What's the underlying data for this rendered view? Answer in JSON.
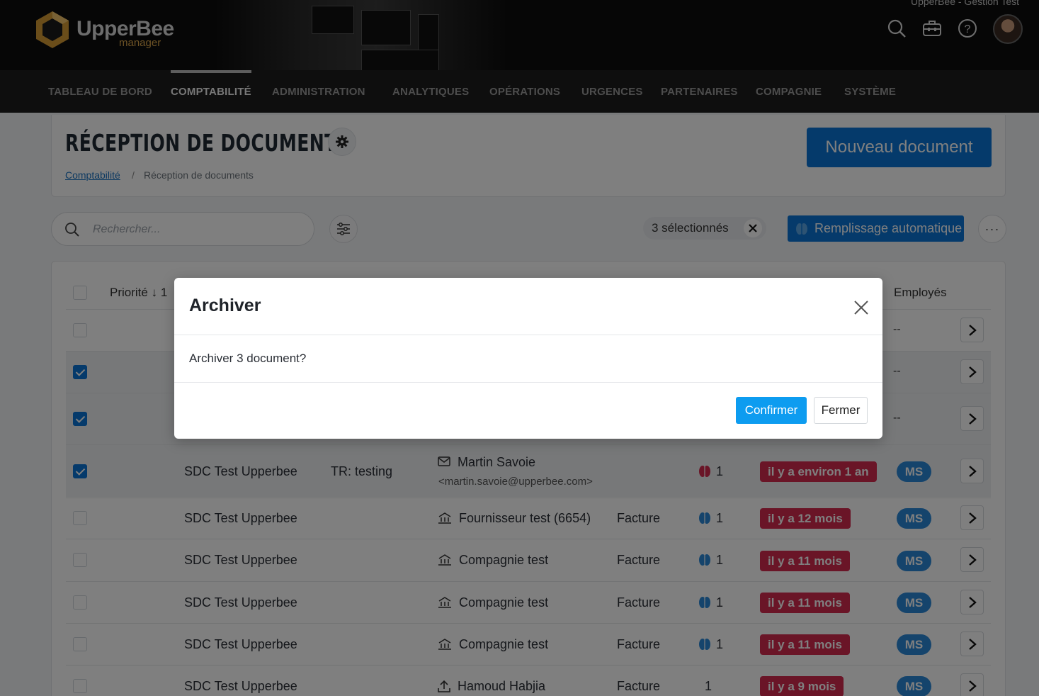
{
  "brand": {
    "name": "UpperBee",
    "sub": "manager",
    "tenant": "UpperBee - Gestion Test"
  },
  "header_icons": [
    "search-icon",
    "toolbox-icon",
    "help-icon"
  ],
  "nav": [
    {
      "label": "TABLEAU DE BORD"
    },
    {
      "label": "COMPTABILITÉ",
      "active": true
    },
    {
      "label": "ADMINISTRATION"
    },
    {
      "label": "ANALYTIQUES"
    },
    {
      "label": "OPÉRATIONS"
    },
    {
      "label": "URGENCES"
    },
    {
      "label": "PARTENAIRES"
    },
    {
      "label": "COMPAGNIE"
    },
    {
      "label": "SYSTÈME"
    }
  ],
  "page": {
    "title": "RÉCEPTION DE DOCUMENTS",
    "breadcrumb": {
      "link": "Comptabilité",
      "sep": "/",
      "current": "Réception de documents"
    },
    "new_button": "Nouveau document"
  },
  "toolbar": {
    "search_placeholder": "Rechercher...",
    "selected": "3 sélectionnés",
    "autofill": "Remplissage automatique",
    "more": "···"
  },
  "table": {
    "headers": {
      "priority": "Priorité",
      "priority_num": "1",
      "employees": "Employés"
    },
    "rows": [
      {
        "checked": false,
        "employees": "--"
      },
      {
        "checked": true,
        "employees": "--"
      },
      {
        "checked": true,
        "employees": "--"
      },
      {
        "checked": true,
        "company": "SDC Test Upperbee",
        "subject": "TR: testing",
        "sender_icon": "mail-icon",
        "sender": "Martin Savoie",
        "sender_email": "<martin.savoie@upperbee.com>",
        "type": "",
        "count": "1",
        "age": "il y a environ 1 an",
        "initials": "MS"
      },
      {
        "checked": false,
        "company": "SDC Test Upperbee",
        "subject": "",
        "sender_icon": "bank-icon",
        "sender": "Fournisseur test (6654)",
        "type": "Facture",
        "count": "1",
        "age": "il y a 12 mois",
        "initials": "MS"
      },
      {
        "checked": false,
        "company": "SDC Test Upperbee",
        "subject": "",
        "sender_icon": "bank-icon",
        "sender": "Compagnie test",
        "type": "Facture",
        "count": "1",
        "age": "il y a 11 mois",
        "initials": "MS"
      },
      {
        "checked": false,
        "company": "SDC Test Upperbee",
        "subject": "",
        "sender_icon": "bank-icon",
        "sender": "Compagnie test",
        "type": "Facture",
        "count": "1",
        "age": "il y a 11 mois",
        "initials": "MS"
      },
      {
        "checked": false,
        "company": "SDC Test Upperbee",
        "subject": "",
        "sender_icon": "bank-icon",
        "sender": "Compagnie test",
        "type": "Facture",
        "count": "1",
        "age": "il y a 11 mois",
        "initials": "MS"
      },
      {
        "checked": false,
        "company": "SDC Test Upperbee",
        "subject": "",
        "sender_icon": "upload-icon",
        "sender": "Hamoud Habjia",
        "type": "Facture",
        "count": "1",
        "age": "il y a 9 mois",
        "initials": "MS"
      }
    ]
  },
  "modal": {
    "title": "Archiver",
    "body": "Archiver 3 document?",
    "confirm": "Confirmer",
    "close": "Fermer"
  },
  "colors": {
    "primary": "#0a74d6",
    "confirm": "#0d9cf0",
    "badge": "#d42a4f",
    "pill": "#2a88d8",
    "nav_bg": "#1c1c1c"
  }
}
